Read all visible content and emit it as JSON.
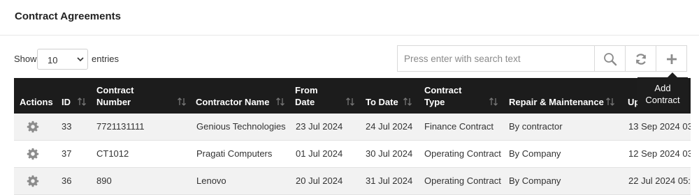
{
  "page": {
    "title": "Contract Agreements"
  },
  "length_menu": {
    "show_label": "Show",
    "selected": "10",
    "entries_label": "entries"
  },
  "search": {
    "placeholder": "Press enter with search text"
  },
  "toolbar": {
    "tooltip": "Add Contract"
  },
  "table": {
    "columns": {
      "actions": "Actions",
      "id": "ID",
      "contract_number_1": "Contract",
      "contract_number_2": "Number",
      "contractor_name": "Contractor Name",
      "from_date_1": "From",
      "from_date_2": "Date",
      "to_date": "To Date",
      "contract_type_1": "Contract",
      "contract_type_2": "Type",
      "repair": "Repair & Maintenance",
      "updated": "Up"
    },
    "rows": [
      {
        "id": "33",
        "contract_number": "7721131111",
        "contractor_name": "Genious Technologies",
        "from_date": "23 Jul 2024",
        "to_date": "24 Jul 2024",
        "contract_type": "Finance Contract",
        "repair": "By contractor",
        "updated": "13 Sep 2024 03:"
      },
      {
        "id": "37",
        "contract_number": "CT1012",
        "contractor_name": "Pragati Computers",
        "from_date": "01 Jul 2024",
        "to_date": "30 Jul 2024",
        "contract_type": "Operating Contract",
        "repair": "By Company",
        "updated": "12 Sep 2024 03:"
      },
      {
        "id": "36",
        "contract_number": "890",
        "contractor_name": "Lenovo",
        "from_date": "20 Jul 2024",
        "to_date": "31 Jul 2024",
        "contract_type": "Operating Contract",
        "repair": "By Company",
        "updated": "22 Jul 2024 05:5"
      }
    ]
  },
  "colors": {
    "header_bg": "#1c1c1c",
    "stripe": "#f2f2f2",
    "icon": "#8c8c8c"
  },
  "icons": {
    "search": "search-icon",
    "refresh": "refresh-icon",
    "add": "plus-icon",
    "row_action": "gear-icon",
    "sort": "sort-icon"
  }
}
